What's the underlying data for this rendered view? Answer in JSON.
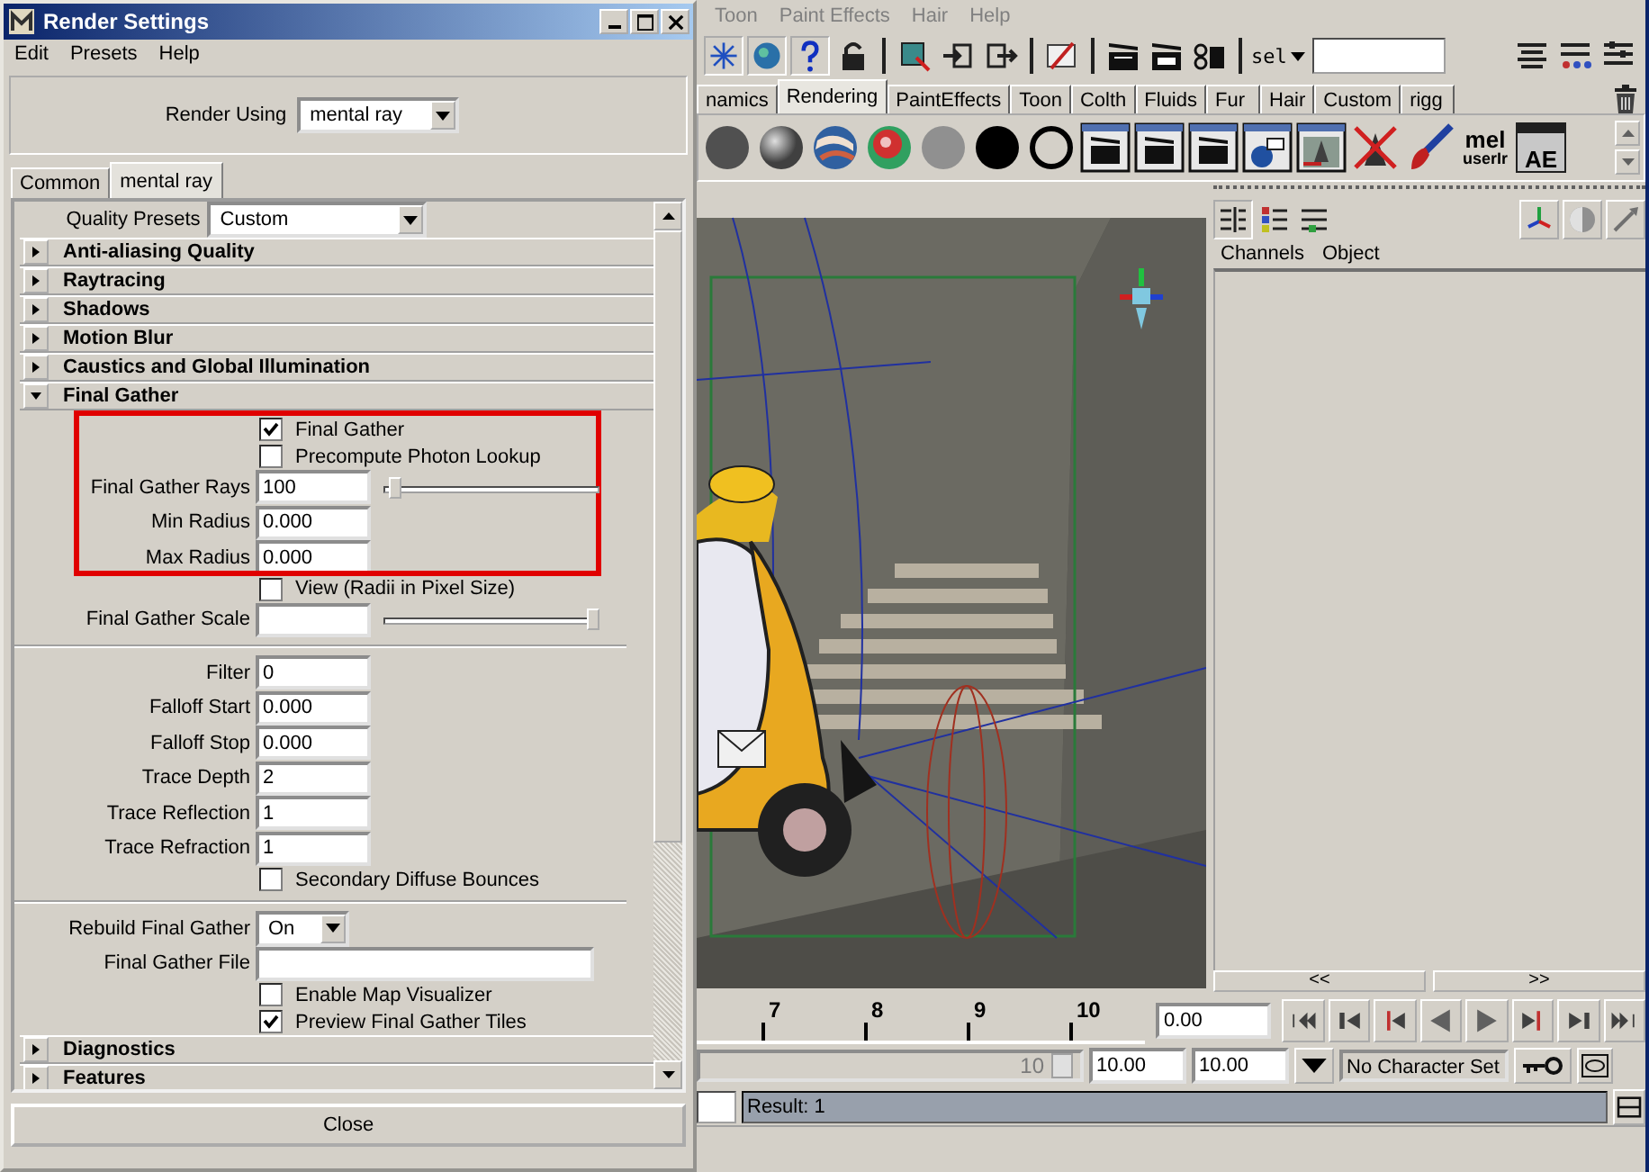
{
  "dialog": {
    "title": "Render Settings",
    "menu": [
      "Edit",
      "Presets",
      "Help"
    ],
    "render_using": {
      "label": "Render Using",
      "value": "mental ray"
    },
    "tabs": [
      {
        "label": "Common",
        "selected": false
      },
      {
        "label": "mental ray",
        "selected": true
      }
    ],
    "quality_presets": {
      "label": "Quality Presets",
      "value": "Custom"
    },
    "sections": [
      {
        "title": "Anti-aliasing Quality",
        "expanded": false
      },
      {
        "title": "Raytracing",
        "expanded": false
      },
      {
        "title": "Shadows",
        "expanded": false
      },
      {
        "title": "Motion Blur",
        "expanded": false
      },
      {
        "title": "Caustics and Global Illumination",
        "expanded": false
      },
      {
        "title": "Final Gather",
        "expanded": true,
        "rows": [
          {
            "kind": "checkbox",
            "label": "Final Gather",
            "checked": true
          },
          {
            "kind": "checkbox",
            "label": "Precompute Photon Lookup",
            "checked": false
          },
          {
            "kind": "slider",
            "label": "Final Gather Rays",
            "value": "100",
            "level": 0.03
          },
          {
            "kind": "field",
            "label": "Min Radius",
            "value": "0.000"
          },
          {
            "kind": "field",
            "label": "Max Radius",
            "value": "0.000"
          },
          {
            "kind": "checkbox",
            "label": "View (Radii in Pixel Size)",
            "checked": false
          },
          {
            "kind": "slider",
            "label": "Final Gather Scale",
            "level": 1
          },
          {
            "kind": "divider"
          },
          {
            "kind": "field",
            "label": "Filter",
            "value": "0"
          },
          {
            "kind": "field",
            "label": "Falloff Start",
            "value": "0.000"
          },
          {
            "kind": "field",
            "label": "Falloff Stop",
            "value": "0.000"
          },
          {
            "kind": "field",
            "label": "Trace Depth",
            "value": "2"
          },
          {
            "kind": "field",
            "label": "Trace Reflection",
            "value": "1"
          },
          {
            "kind": "field",
            "label": "Trace Refraction",
            "value": "1"
          },
          {
            "kind": "checkbox",
            "label": "Secondary Diffuse Bounces",
            "checked": false
          },
          {
            "kind": "divider"
          },
          {
            "kind": "dropdown",
            "label": "Rebuild Final Gather",
            "value": "On"
          },
          {
            "kind": "wide_field",
            "label": "Final Gather File"
          },
          {
            "kind": "checkbox",
            "label": "Enable Map Visualizer",
            "checked": false
          },
          {
            "kind": "checkbox",
            "label": "Preview Final Gather Tiles",
            "checked": true
          }
        ]
      },
      {
        "title": "Diagnostics",
        "expanded": false
      },
      {
        "title": "Features",
        "expanded": false
      }
    ],
    "close_button": "Close"
  },
  "maya": {
    "menu": [
      "Toon",
      "Paint Effects",
      "Hair",
      "Help"
    ],
    "sel_label": "sel",
    "shelf_tabs": [
      {
        "label": "namics",
        "selected": false
      },
      {
        "label": "Rendering",
        "selected": true
      },
      {
        "label": "PaintEffects",
        "selected": false
      },
      {
        "label": "Toon",
        "selected": false
      },
      {
        "label": "Colth",
        "selected": false
      },
      {
        "label": "Fluids",
        "selected": false
      },
      {
        "label": "Fur",
        "selected": false
      },
      {
        "label": "Hair",
        "selected": false
      },
      {
        "label": "Custom",
        "selected": false
      },
      {
        "label": "rigg",
        "selected": false
      }
    ],
    "shelf_text_buttons": [
      {
        "lines": [
          "mel",
          "userIr"
        ]
      },
      {
        "lines": [
          "AE"
        ]
      }
    ],
    "channel_box_menu": [
      "Channels",
      "Object"
    ],
    "scroll_buttons": [
      "<<",
      ">>"
    ],
    "time_ticks": [
      "7",
      "8",
      "9",
      "10"
    ],
    "current_time": "0.00",
    "range_end_label": "10",
    "range_start": "10.00",
    "range_end": "10.00",
    "character_set": "No Character Set",
    "result": "Result: 1"
  }
}
